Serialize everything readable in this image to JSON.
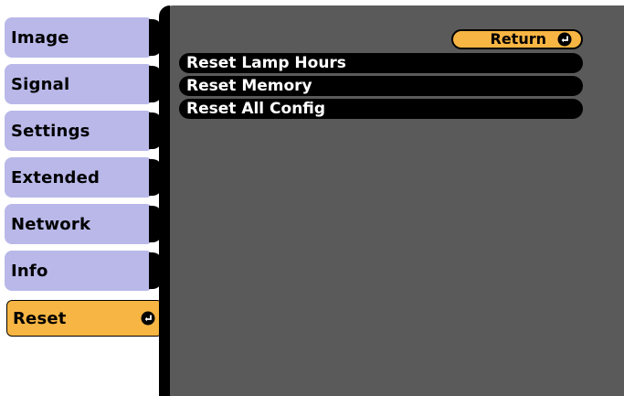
{
  "sidebar": {
    "items": [
      {
        "label": "Image",
        "active": false
      },
      {
        "label": "Signal",
        "active": false
      },
      {
        "label": "Settings",
        "active": false
      },
      {
        "label": "Extended",
        "active": false
      },
      {
        "label": "Network",
        "active": false
      },
      {
        "label": "Info",
        "active": false
      },
      {
        "label": "Reset",
        "active": true
      }
    ]
  },
  "panel": {
    "return_label": "Return",
    "menu_items": [
      {
        "label": "Reset Lamp Hours"
      },
      {
        "label": "Reset Memory"
      },
      {
        "label": "Reset All Config"
      }
    ]
  },
  "icons": {
    "enter": "enter-icon"
  },
  "colors": {
    "sidebar_inactive": "#b9b8e9",
    "sidebar_active": "#f7b543",
    "panel_bg": "#5a5a5a",
    "menu_row_bg": "#000000",
    "return_button_bg": "#f7b543"
  }
}
